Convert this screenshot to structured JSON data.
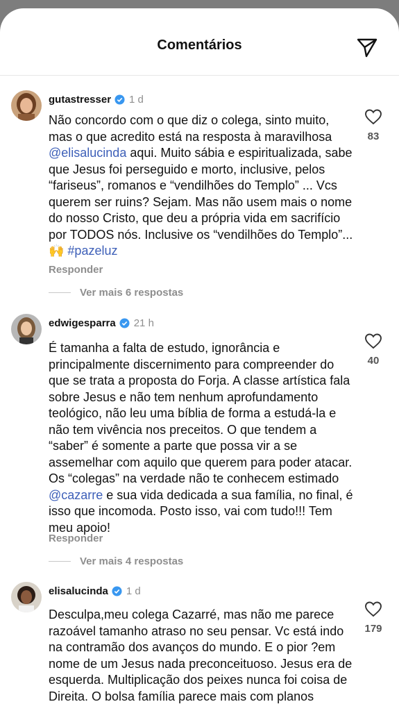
{
  "header": {
    "title": "Comentários",
    "send_icon": "paper-plane-icon"
  },
  "colors": {
    "link": "#3d5fb8",
    "muted": "#8e8e8e",
    "verified": "#3897f0"
  },
  "comments": [
    {
      "username": "gutastresser",
      "time": "1 d",
      "verified": true,
      "likes": "83",
      "text_parts": [
        "Não concordo com o que diz o colega, sinto muito, mas o que acredito está na resposta à maravilhosa ",
        "@elisalucinda",
        " aqui. Muito sábia e espiritualizada, sabe que Jesus foi perseguido e morto, inclusive, pelos “fariseus”, romanos e “vendilhões do Templo” ... Vcs querem ser ruins? Sejam. Mas não usem mais o nome do nosso Cristo, que deu a própria vida em sacrifício por TODOS nós. Inclusive os “vendilhões do Templo”... 🙌 ",
        "#pazeluz"
      ],
      "reply_label": "Responder",
      "more_label": "Ver mais 6 respostas"
    },
    {
      "username": "edwigesparra",
      "time": "21 h",
      "verified": true,
      "likes": "40",
      "text_parts": [
        "É tamanha a falta de estudo, ignorância e principalmente discernimento para compreender do que se trata a proposta do Forja. A classe artística fala sobre Jesus e não tem nenhum aprofundamento teológico, não leu uma bíblia de forma a estudá-la e não tem vivência nos preceitos. O que tendem a “saber” é somente a parte que possa vir a se assemelhar com aquilo que querem para poder atacar. Os “colegas” na verdade não te conhecem estimado ",
        "@cazarre",
        " e sua vida dedicada a sua família, no final, é isso que incomoda. Posto isso, vai com tudo!!! Tem meu apoio!"
      ],
      "reply_label": "Responder",
      "more_label": "Ver mais 4 respostas"
    },
    {
      "username": "elisalucinda",
      "time": "1 d",
      "verified": true,
      "likes": "179",
      "text_parts": [
        "Desculpa,meu colega  Cazarré, mas não me parece razoável tamanho atraso no seu pensar. Vc está indo na contramão dos avanços do mundo. E o pior ?em nome de um Jesus nada preconceituoso. Jesus  era de esquerda. Multiplicação  dos peixes nunca foi coisa de Direita. O bolsa família parece mais com planos"
      ]
    }
  ]
}
